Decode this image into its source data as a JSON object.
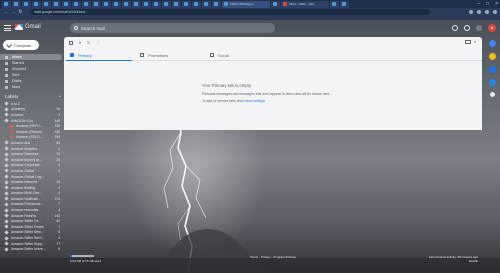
{
  "browser": {
    "active_tab_title": "AWS CSS Report",
    "tab_titles": [
      "Inbox - AMA…(40)"
    ],
    "url": "mail.google.com/mail/u/0/#inbox"
  },
  "gmail": {
    "logo_word": "Gmail",
    "search_placeholder": "Search mail",
    "avatar_letter": "A"
  },
  "sidebar": {
    "compose": "Compose",
    "nav": [
      {
        "label": "Inbox",
        "count": ""
      },
      {
        "label": "Starred",
        "count": ""
      },
      {
        "label": "Snoozed",
        "count": ""
      },
      {
        "label": "Sent",
        "count": ""
      },
      {
        "label": "Drafts",
        "count": ""
      },
      {
        "label": "More",
        "count": ""
      }
    ],
    "labels_header": "Labels",
    "labels": [
      {
        "label": "A to Z",
        "count": "",
        "sub": false
      },
      {
        "label": "Academy",
        "count": "16",
        "sub": false
      },
      {
        "label": "Amazon",
        "count": "3",
        "sub": false
      },
      {
        "label": "AMAZON (Cs)",
        "count": "446",
        "sub": false
      },
      {
        "label": "Amazon (REFU...",
        "count": "195",
        "sub": true
      },
      {
        "label": "Amazon (Return)",
        "count": "130",
        "sub": true
      },
      {
        "label": "Amazon (SOLD...",
        "count": "154",
        "sub": true
      },
      {
        "label": "Amazon Ads",
        "count": "84",
        "sub": false
      },
      {
        "label": "Amazon Answers",
        "count": "2",
        "sub": false
      },
      {
        "label": "Amazon Business",
        "count": "20",
        "sub": false
      },
      {
        "label": "Amazon buyer's m...",
        "count": "26",
        "sub": false
      },
      {
        "label": "Amazon Corporate",
        "count": "4",
        "sub": false
      },
      {
        "label": "Amazon Global",
        "count": "4",
        "sub": false
      },
      {
        "label": "Amazon Global Logi...",
        "count": "",
        "sub": false
      },
      {
        "label": "Amazon Inbound",
        "count": "19",
        "sub": false
      },
      {
        "label": "amazon lending",
        "count": "4",
        "sub": false
      },
      {
        "label": "Amazon Multi-Cha...",
        "count": "4",
        "sub": false
      },
      {
        "label": "Amazon Notificati...",
        "count": "374",
        "sub": false
      },
      {
        "label": "Amazon Reimburse...",
        "count": "7",
        "sub": false
      },
      {
        "label": "Amazon removals",
        "count": "4",
        "sub": false
      },
      {
        "label": "Amazon Returns",
        "count": "193",
        "sub": false
      },
      {
        "label": "Amazon Seller Ce...",
        "count": "62",
        "sub": false
      },
      {
        "label": "Amazon Seller Forum",
        "count": "7",
        "sub": false
      },
      {
        "label": "Amazon Seller New...",
        "count": "8",
        "sub": false
      },
      {
        "label": "Amazon Seller Servi...",
        "count": "4",
        "sub": false
      },
      {
        "label": "Amazon Seller Supp...",
        "count": "77",
        "sub": false
      },
      {
        "label": "Amazon Seller Unive...",
        "count": "6",
        "sub": false
      }
    ]
  },
  "main": {
    "tabs": [
      {
        "label": "Primary",
        "icon": "inbox-icon"
      },
      {
        "label": "Promotions",
        "icon": "tag-icon"
      },
      {
        "label": "Social",
        "icon": "people-icon"
      }
    ],
    "empty_title": "Your Primary tab is empty.",
    "empty_line1": "Personal messages and messages that don't appear in other tabs will be shown here.",
    "empty_line2_prefix": "To add or remove tabs click ",
    "empty_line2_link": "inbox settings."
  },
  "footer": {
    "storage": "0.03 GB of 15 GB used",
    "links": "Terms · Privacy · Program Policies",
    "activity": "Last account activity: 28 minutes ago",
    "details": "Details"
  },
  "colors": {
    "accent": "#1a73e8",
    "avatar": "#d9483b"
  }
}
